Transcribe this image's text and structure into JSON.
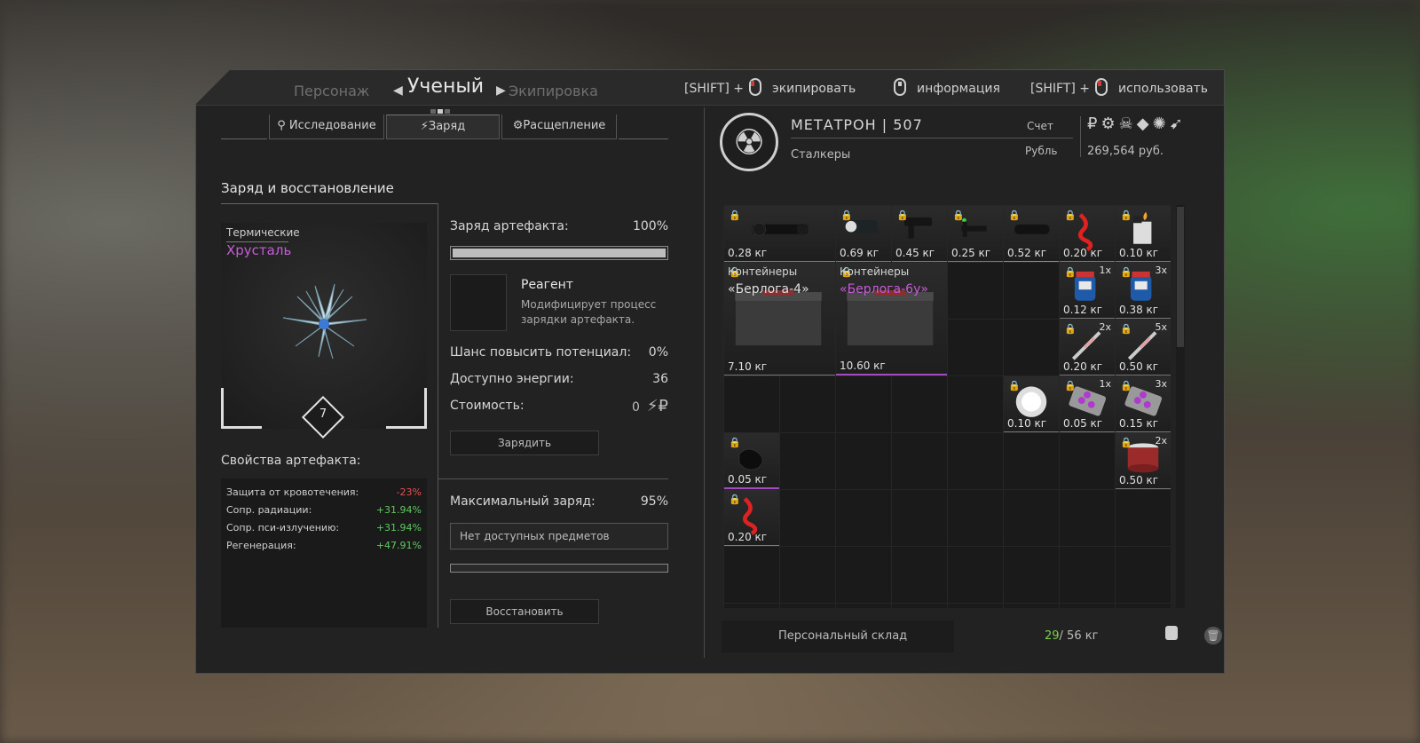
{
  "nav": {
    "prev": "Персонаж",
    "current": "Ученый",
    "next": "Экипировка"
  },
  "hints": [
    {
      "prefix": "[SHIFT] +",
      "label": "экипировать"
    },
    {
      "prefix": "",
      "label": "информация"
    },
    {
      "prefix": "[SHIFT] +",
      "label": "использовать"
    }
  ],
  "tabs": [
    {
      "icon": "search-icon",
      "label": "Исследование"
    },
    {
      "icon": "lightning-icon",
      "label": "Заряд"
    },
    {
      "icon": "gear-icon",
      "label": "Расщепление"
    }
  ],
  "section_title": "Заряд и восстановление",
  "artifact": {
    "type": "Термические",
    "name": "Хрусталь",
    "level": "7",
    "props_title": "Свойства артефакта:",
    "props": [
      {
        "label": "Защита от кровотечения:",
        "value": "-23%",
        "sign": "neg"
      },
      {
        "label": "Сопр. радиации:",
        "value": "+31.94%",
        "sign": "pos"
      },
      {
        "label": "Сопр. пси-излучению:",
        "value": "+31.94%",
        "sign": "pos"
      },
      {
        "label": "Регенерация:",
        "value": "+47.91%",
        "sign": "pos"
      }
    ]
  },
  "charge": {
    "label": "Заряд артефакта:",
    "value": "100%",
    "fill": 1.0,
    "reagent_title": "Реагент",
    "reagent_desc": "Модифицирует процесс зарядки артефакта.",
    "chance_label": "Шанс повысить потенциал:",
    "chance_value": "0%",
    "energy_label": "Доступно энергии:",
    "energy_value": "36",
    "cost_label": "Стоимость:",
    "cost_value": "0",
    "charge_button": "Зарядить"
  },
  "restore": {
    "max_label": "Максимальный заряд:",
    "max_value": "95%",
    "no_items": "Нет доступных предметов",
    "fill": 0.0,
    "button": "Восстановить"
  },
  "player": {
    "name": "МЕТАТРОН",
    "number": "507",
    "faction": "Сталкеры",
    "account_label": "Счет",
    "currency_label": "Рубль",
    "balance": "269,564 руб."
  },
  "inventory": [
    {
      "w": "0.28 кг",
      "style": "blue"
    },
    {
      "w": "0.69 кг",
      "style": ""
    },
    {
      "w": "0.45 кг",
      "style": ""
    },
    {
      "w": "0.25 кг",
      "style": ""
    },
    {
      "w": "0.52 кг",
      "style": "teal"
    },
    {
      "w": "0.20 кг",
      "style": ""
    },
    {
      "w": "0.10 кг",
      "style": ""
    },
    {
      "category": "Контейнеры",
      "name": "«Берлога-4»",
      "w": "7.10 кг",
      "style": ""
    },
    {
      "category": "Контейнеры",
      "name": "«Берлога-6у»",
      "w": "10.60 кг",
      "style": "purple"
    },
    {
      "w": "0.12 кг",
      "count": "1x",
      "style": ""
    },
    {
      "w": "0.38 кг",
      "count": "3x",
      "style": ""
    },
    {
      "w": "0.20 кг",
      "count": "2x",
      "style": ""
    },
    {
      "w": "0.50 кг",
      "count": "5x",
      "style": ""
    },
    {
      "w": "0.10 кг",
      "style": ""
    },
    {
      "w": "0.05 кг",
      "count": "1x",
      "style": ""
    },
    {
      "w": "0.15 кг",
      "count": "3x",
      "style": ""
    },
    {
      "w": "0.05 кг",
      "style": "purple"
    },
    {
      "w": "0.50 кг",
      "count": "2x",
      "style": ""
    },
    {
      "w": "0.20 кг",
      "style": "blue"
    }
  ],
  "footer": {
    "stash": "Персональный склад",
    "weight_cur": "29",
    "weight_max": "/ 56 кг"
  }
}
